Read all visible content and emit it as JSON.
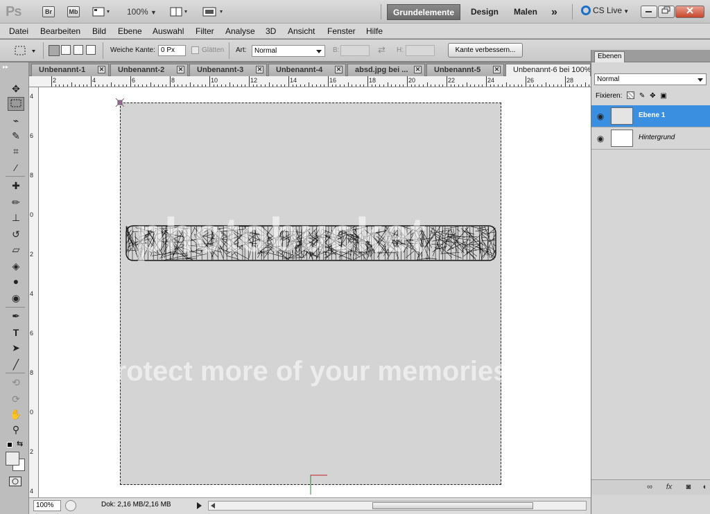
{
  "appbar": {
    "logo": "Ps",
    "bridge": "Br",
    "minibridge": "Mb",
    "zoom": "100%",
    "workspaces": [
      "Grundelemente",
      "Design",
      "Malen"
    ],
    "more": "»",
    "cslive": "CS Live"
  },
  "menu": [
    "Datei",
    "Bearbeiten",
    "Bild",
    "Ebene",
    "Auswahl",
    "Filter",
    "Analyse",
    "3D",
    "Ansicht",
    "Fenster",
    "Hilfe"
  ],
  "options": {
    "feather_label": "Weiche Kante:",
    "feather_value": "0 Px",
    "antialias_label": "Glätten",
    "style_label": "Art:",
    "style_value": "Normal",
    "width_label": "B:",
    "height_label": "H:",
    "refine_button": "Kante verbessern..."
  },
  "tabs": [
    {
      "label": "Unbenannt-1"
    },
    {
      "label": "Unbenannt-2"
    },
    {
      "label": "Unbenannt-3"
    },
    {
      "label": "Unbenannt-4"
    },
    {
      "label": "absd.jpg bei ..."
    },
    {
      "label": "Unbenannt-5"
    },
    {
      "label": "Unbenannt-6 bei 100%"
    }
  ],
  "ruler_top": [
    "2",
    "4",
    "6",
    "8",
    "10",
    "12",
    "14",
    "16",
    "18",
    "20",
    "22",
    "24",
    "26",
    "28"
  ],
  "ruler_left": [
    "4",
    "6",
    "8",
    "0",
    "2",
    "4",
    "6",
    "8",
    "0",
    "2",
    "4"
  ],
  "watermark": {
    "line1": "photobucket",
    "line2": "Protect more of your memories for less!"
  },
  "status": {
    "zoom": "100%",
    "doc": "Dok: 2,16 MB/2,16 MB"
  },
  "layers_panel": {
    "tab": "Ebenen",
    "blend_mode": "Normal",
    "lock_label": "Fixieren:",
    "layers": [
      {
        "name": "Ebene 1",
        "active": true
      },
      {
        "name": "Hintergrund",
        "active": false
      }
    ]
  }
}
